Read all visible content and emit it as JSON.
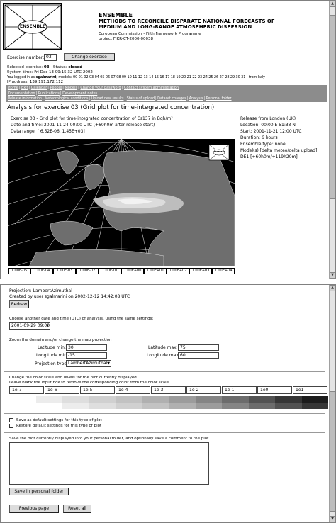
{
  "header": {
    "app_name": "ENSEMBLE",
    "logo_text": "ENSEMBLE",
    "subtitle_line1": "METHODS TO RECONCILE DISPARATE NATIONAL FORECASTS OF",
    "subtitle_line2": "MEDIUM AND LONG-RANGE ATMOSPHERIC DISPERSION",
    "programme": "European Commission - Fifth Framework Programme",
    "project": "project FIKR-CT-2000-00038"
  },
  "exercise": {
    "label": "Exercise number:",
    "value": "03",
    "change_button": "Change exercise",
    "selected_prefix": "Selected exercise:",
    "selected_value": "03",
    "status_label": "Status:",
    "status_value": "closed",
    "system_time": "System time: Fri Dec 13 09:15:32 UTC 2002",
    "logged_prefix": "You logged in as",
    "logged_user": "sgalmarini",
    "models_label": "; models:",
    "models_list": "00 01 02 03 04 05 06 07 08 09 10 11 12 13 14 15 16 17 18 19 20 21 22 23 24 25 26 27 28 29 30 31",
    "models_suffix": "| from Italy",
    "ip": "IP address: 139.191.172.112"
  },
  "nav": {
    "row1": [
      "Home",
      "Exit",
      "Calendar",
      "People",
      "Models",
      "Change your password",
      "Contact system administration"
    ],
    "row2": [
      "Documentation",
      "Publications",
      "Development notes"
    ],
    "row3": [
      "Release information",
      "Meteorological conditions",
      "Upload new results",
      "Status of upload",
      "Dataset changes",
      "Analysis",
      "Personal folder"
    ]
  },
  "analysis": {
    "title": "Analysis for exercise 03 (Grid plot for time-integrated concentration)",
    "line1": "Exercise 03 - Grid plot for time-integrated concentration of Cs137 in Bqh/m³",
    "line2": "Date and time: 2001-11-24 00:00 UTC (+60h0m after release start)",
    "line3": "Data range: [ 6.52E-06, 1.45E+03]",
    "release_from": "Release from London (UK)",
    "location": "Location: 00:00 E 51:33 N",
    "start": "Start: 2001-11-21 12:00 UTC",
    "duration": "Duration: 6 hours",
    "ensemble_type": "Ensemble type: none",
    "models_label": "Model(s) [delta meteo/delta upload]",
    "models_value": "DE1 [+60h0m/+119h20m]",
    "map_logo": "ENSEMBLE",
    "legend": [
      "1.00E-05",
      "1.00E-04",
      "1.00E-03",
      "1.00E-02",
      "1.00E-01",
      "1.00E+00",
      "1.00E+01",
      "1.00E+02",
      "1.00E+03",
      "1.00E+04"
    ]
  },
  "projection": {
    "label": "Projection:",
    "value": "LambertAzimuthal",
    "created": "Created by user sgalmarini on 2002-12-12 14:42:08 UTC",
    "redraw_button": "Redraw"
  },
  "datetime": {
    "caption": "Choose another date and time (UTC) of analysis, using the same settings:",
    "selected": "2001-09-29 09:00"
  },
  "zoom": {
    "caption": "Zoom the domain and/or change the map projection",
    "lat_min_label": "Latitude min:",
    "lat_min": "30",
    "lat_max_label": "Latitude max:",
    "lat_max": "75",
    "lon_min_label": "Longitude min:",
    "lon_min": "-15",
    "lon_max_label": "Longitude max:",
    "lon_max": "60",
    "proj_type_label": "Projection type:",
    "proj_type": "LambertAzimuthal"
  },
  "colorscale": {
    "caption1": "Change the color scale and levels for the plot currently displayed",
    "caption2": "Leave blank the input box to remove the corresponding color from the color scale.",
    "levels": [
      "1e-7",
      "1e-6",
      "1e-5",
      "1e-4",
      "1e-3",
      "1e-2",
      "1e-1",
      "1e0",
      "1e1"
    ],
    "swatches": [
      "#ffffff",
      "#ececec",
      "#dedede",
      "#d0d0d0",
      "#c2c2c2",
      "#b0b0b0",
      "#9c9c9c",
      "#858585",
      "#6c6c6c",
      "#525252",
      "#363636",
      "#1c1c1c"
    ]
  },
  "defaults": {
    "save_label": "Save as default settings for this type of plot",
    "restore_label": "Restore default settings for this type of plot"
  },
  "folder": {
    "caption": "Save the plot currently displayed into your personal folder, and optionally save a comment to the plot",
    "comment": "",
    "save_button": "Save in personal folder"
  },
  "bottom": {
    "prev_button": "Previous page",
    "reset_button": "Reset all"
  }
}
